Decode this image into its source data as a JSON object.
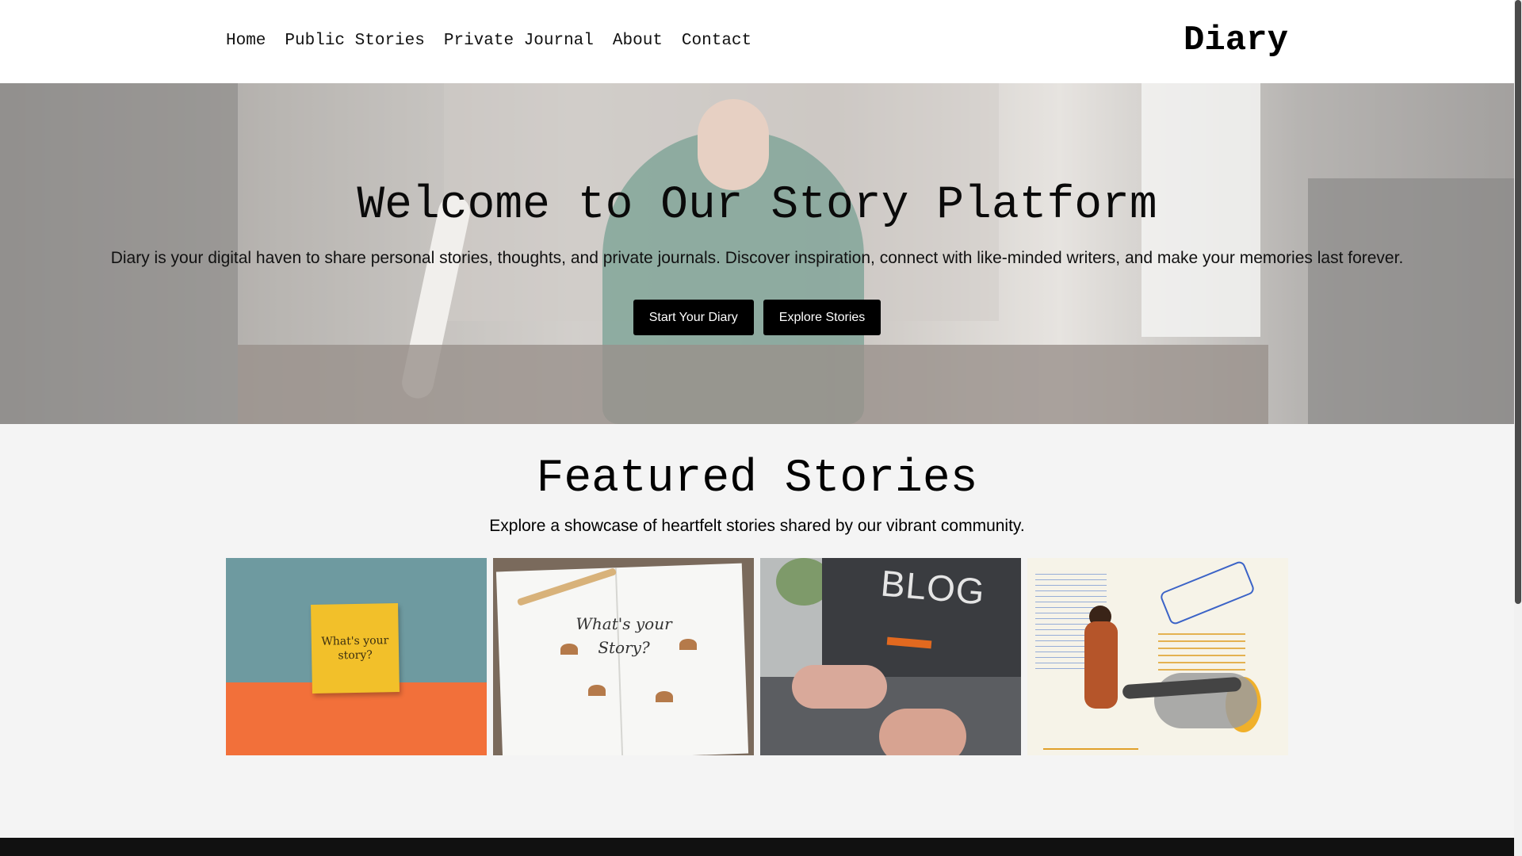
{
  "header": {
    "nav": [
      "Home",
      "Public Stories",
      "Private Journal",
      "About",
      "Contact"
    ],
    "brand": "Diary"
  },
  "hero": {
    "title": "Welcome to Our Story Platform",
    "subtitle": "Diary is your digital haven to share personal stories, thoughts, and private journals. Discover inspiration, connect with like-minded writers, and make your memories last forever.",
    "buttons": [
      "Start Your Diary",
      "Explore Stories"
    ]
  },
  "featured": {
    "title": "Featured Stories",
    "subtitle": "Explore a showcase of heartfelt stories shared by our vibrant community.",
    "cards": [
      {
        "image_text": "What's your story?"
      },
      {
        "image_text": "What's your Story?"
      },
      {
        "image_text": "BLOG"
      },
      {
        "image_text": ""
      }
    ]
  },
  "colors": {
    "button_bg": "#000000",
    "page_bg": "#f4f4f4",
    "footer_bg": "#111111"
  }
}
